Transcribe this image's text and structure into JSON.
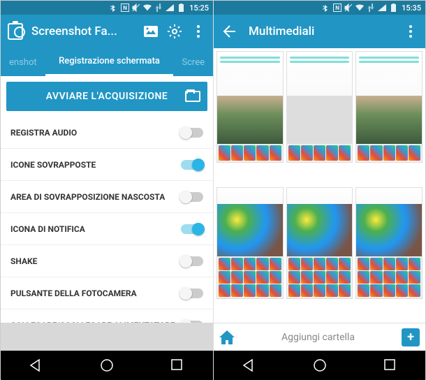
{
  "left": {
    "status_time": "15:25",
    "app_title": "Screenshot Fa...",
    "tabs": {
      "prev": "enshot",
      "active": "Registrazione schermata",
      "next": "Scree"
    },
    "main_button": "AVVIARE L'ACQUISIZIONE",
    "settings": [
      {
        "label": "REGISTRA AUDIO",
        "on": false
      },
      {
        "label": "ICONE SOVRAPPOSTE",
        "on": true
      },
      {
        "label": "AREA DI SOVRAPPOSIZIONE NASCOSTA",
        "on": false
      },
      {
        "label": "ICONA DI NOTIFICA",
        "on": true
      },
      {
        "label": "SHAKE",
        "on": false
      },
      {
        "label": "PULSANTE DELLA FOTOCAMERA",
        "on": false
      },
      {
        "label": "COLLEGARE/SCOLLEGARE ALIMENTATORE",
        "on": false
      }
    ]
  },
  "right": {
    "status_time": "15:35",
    "app_title": "Multimediali",
    "add_folder": "Aggiungi cartella"
  },
  "icons": {
    "bluetooth": "bluetooth",
    "nfc": "N",
    "nosound": "nosound",
    "wifi": "wifi",
    "signal": "signal",
    "battery": "battery"
  }
}
